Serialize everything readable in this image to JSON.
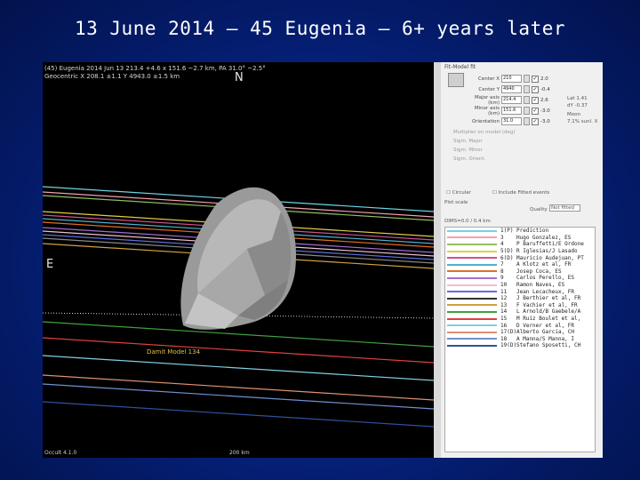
{
  "slide": {
    "title": "13 June 2014 – 45 Eugenia – 6+ years later"
  },
  "plot": {
    "header_line1": "(45) Eugenia 2014 Jun 13  213.4 +4.6 x 151.6 ~2.7 km, PA 31.0° ~2.5°",
    "header_line2": "Geocentric X 208.1 ±1.1  Y 4943.0 ±1.5 km",
    "north_label": "N",
    "east_label": "E",
    "model_label": "Damit Model 134",
    "bottom_left": "Occult 4.1.0",
    "bottom_scale": "200 km"
  },
  "panel": {
    "title": "Fit-Model fit",
    "rows": [
      {
        "label": "Center X",
        "value": "210",
        "checked": "✓",
        "extra": "2.0"
      },
      {
        "label": "Center Y",
        "value": "4940",
        "checked": "✓",
        "extra": "-0.4"
      },
      {
        "label": "Major axis (km)",
        "value": "214.4",
        "checked": "✓",
        "extra": "2.6"
      },
      {
        "label": "Minor axis (km)",
        "value": "151.6",
        "checked": "✓",
        "extra": "-3.0"
      },
      {
        "label": "Orientation",
        "value": "31.0",
        "checked": "✓",
        "extra": "-3.0"
      }
    ],
    "side_notes": [
      "Lat 1.41",
      "dY -0.37",
      "Moon",
      "7.1% sunl. X"
    ],
    "sub_rows": [
      "Multiplier on model (deg)",
      "Sigm. Major",
      "Sigm. Minor",
      "Sigm. Orient."
    ],
    "checkbox_labels": [
      "Circular",
      "Include Fitted events"
    ],
    "plot_scale_label": "Plot scale",
    "quality_label": "Quality",
    "quality_value": "Not fitted",
    "dims_label": "DIMS=0.0 / 0.4 km"
  },
  "chords": [
    {
      "num": "1",
      "flag": "(P)",
      "name": "Prediction",
      "color": "#6fd4e6"
    },
    {
      "num": "3",
      "flag": "",
      "name": "Hugo Gonzalez, ES",
      "color": "#f2a0b0"
    },
    {
      "num": "4",
      "flag": "",
      "name": "P Baruffetti/E Ordone",
      "color": "#90c060"
    },
    {
      "num": "5",
      "flag": "(D)",
      "name": "R Iglesias/J Lasado",
      "color": "#e0d040"
    },
    {
      "num": "6",
      "flag": "(D)",
      "name": "Mauricio Audejuan, PT",
      "color": "#d05090"
    },
    {
      "num": "7",
      "flag": "",
      "name": "A Klotz et al, FR",
      "color": "#50b0d0"
    },
    {
      "num": "8",
      "flag": "",
      "name": "Josep Coca, ES",
      "color": "#e07020"
    },
    {
      "num": "9",
      "flag": "",
      "name": "Carlos Perello, ES",
      "color": "#a070d0"
    },
    {
      "num": "10",
      "flag": "",
      "name": "Ramon Naves, ES",
      "color": "#f0c0d0"
    },
    {
      "num": "11",
      "flag": "",
      "name": "Jean Lecacheux, FR",
      "color": "#6070e0"
    },
    {
      "num": "12",
      "flag": "",
      "name": "J Berthier et al, FR",
      "color": "#303030"
    },
    {
      "num": "13",
      "flag": "",
      "name": "F Vachier et al, FR",
      "color": "#d0a040"
    },
    {
      "num": "14",
      "flag": "",
      "name": "L Arnold/B Gaebele/A",
      "color": "#40a040"
    },
    {
      "num": "15",
      "flag": "",
      "name": "M Ruiz Boulet et al,",
      "color": "#e04040"
    },
    {
      "num": "16",
      "flag": "",
      "name": "D Verner et al, FR",
      "color": "#80d0e0"
    },
    {
      "num": "17",
      "flag": "(D)",
      "name": "Alberto Garcia, CH",
      "color": "#e09070"
    },
    {
      "num": "18",
      "flag": "",
      "name": "A Manna/S Manna, I",
      "color": "#7090d0"
    },
    {
      "num": "19",
      "flag": "(D)",
      "name": "Stefano Sposetti, CH",
      "color": "#3050a0"
    }
  ],
  "colors": {
    "background": "#07268a",
    "title_text": "#ffffff"
  }
}
